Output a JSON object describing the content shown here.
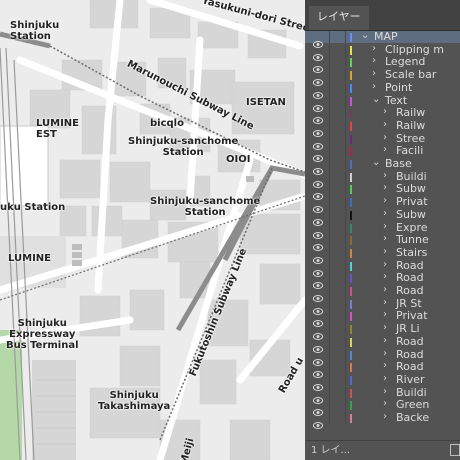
{
  "map": {
    "labels": {
      "shinjuku_station": "Shinjuku\nStation",
      "yasukuni_dori": "Yasukuni-dori Street",
      "marunouchi_line": "Marunouchi Subway Line",
      "isetan": "ISETAN",
      "lumine_est": "LUMINE\nEST",
      "bicqlo": "bicqlo",
      "sanchome_station_1": "Shinjuku-sanchome\nStation",
      "oioi": "OIOI",
      "sanchome_station_2": "Shinjuku-sanchome\nStation",
      "uku_station": "uku Station",
      "lumine": "LUMINE",
      "fukutoshin_line": "Fukutoshin Subway Line",
      "expressway_bus": "Shinjuku\nExpressway\nBus Terminal",
      "takashimaya": "Shinjuku\nTakashimaya",
      "road_u": "Road u",
      "meiji": "Meiji"
    }
  },
  "panel": {
    "tab_label": "レイヤー",
    "footer_count": "1 レイ...",
    "layers": [
      {
        "name": "MAP",
        "level": 0,
        "expanded": true,
        "color": "#6b8cff",
        "selected": true
      },
      {
        "name": "Clipping m",
        "level": 1,
        "expanded": false,
        "color": "#e8e34a"
      },
      {
        "name": "Legend",
        "level": 1,
        "expanded": false,
        "color": "#5fd35a"
      },
      {
        "name": "Scale bar",
        "level": 1,
        "expanded": false,
        "color": "#d8a23a"
      },
      {
        "name": "Point",
        "level": 1,
        "expanded": false,
        "color": "#4a86ff"
      },
      {
        "name": "Text",
        "level": 1,
        "expanded": true,
        "color": "#d14df0"
      },
      {
        "name": "Railw",
        "level": 2,
        "expanded": false,
        "color": "#7a3b5b"
      },
      {
        "name": "Railw",
        "level": 2,
        "expanded": false,
        "color": "#e04444"
      },
      {
        "name": "Stree",
        "level": 2,
        "expanded": false,
        "color": "#6a2a7a"
      },
      {
        "name": "Facili",
        "level": 2,
        "expanded": false,
        "color": "#a8264a"
      },
      {
        "name": "Base",
        "level": 1,
        "expanded": true,
        "color": "#4d6cc9"
      },
      {
        "name": "Buildi",
        "level": 2,
        "expanded": false,
        "color": "#cfcfcf"
      },
      {
        "name": "Subw",
        "level": 2,
        "expanded": false,
        "color": "#4fd05a"
      },
      {
        "name": "Privat",
        "level": 2,
        "expanded": false,
        "color": "#3d6bd0"
      },
      {
        "name": "Subw",
        "level": 2,
        "expanded": false,
        "color": "#111111"
      },
      {
        "name": "Expre",
        "level": 2,
        "expanded": false,
        "color": "#2e8a6a"
      },
      {
        "name": "Tunne",
        "level": 2,
        "expanded": false,
        "color": "#8a6a2e"
      },
      {
        "name": "Stairs",
        "level": 2,
        "expanded": false,
        "color": "#c98a3a"
      },
      {
        "name": "Road",
        "level": 2,
        "expanded": false,
        "color": "#4fd0d8"
      },
      {
        "name": "Road",
        "level": 2,
        "expanded": false,
        "color": "#6a4fd8"
      },
      {
        "name": "Road",
        "level": 2,
        "expanded": false,
        "color": "#d04f8a"
      },
      {
        "name": "JR St",
        "level": 2,
        "expanded": false,
        "color": "#7a7ad8"
      },
      {
        "name": "Privat",
        "level": 2,
        "expanded": false,
        "color": "#d84fd0"
      },
      {
        "name": "JR Li",
        "level": 2,
        "expanded": false,
        "color": "#8a8a2e"
      },
      {
        "name": "Road",
        "level": 2,
        "expanded": false,
        "color": "#d8d84f"
      },
      {
        "name": "Road",
        "level": 2,
        "expanded": false,
        "color": "#4f8ad8"
      },
      {
        "name": "Road",
        "level": 2,
        "expanded": false,
        "color": "#d87a4f"
      },
      {
        "name": "River",
        "level": 2,
        "expanded": false,
        "color": "#4f6ad8"
      },
      {
        "name": "Buildi",
        "level": 2,
        "expanded": false,
        "color": "#d84f4f"
      },
      {
        "name": "Green",
        "level": 2,
        "expanded": false,
        "color": "#2ea84a"
      },
      {
        "name": "Backe",
        "level": 2,
        "expanded": false,
        "color": "#d87a9a"
      }
    ]
  }
}
